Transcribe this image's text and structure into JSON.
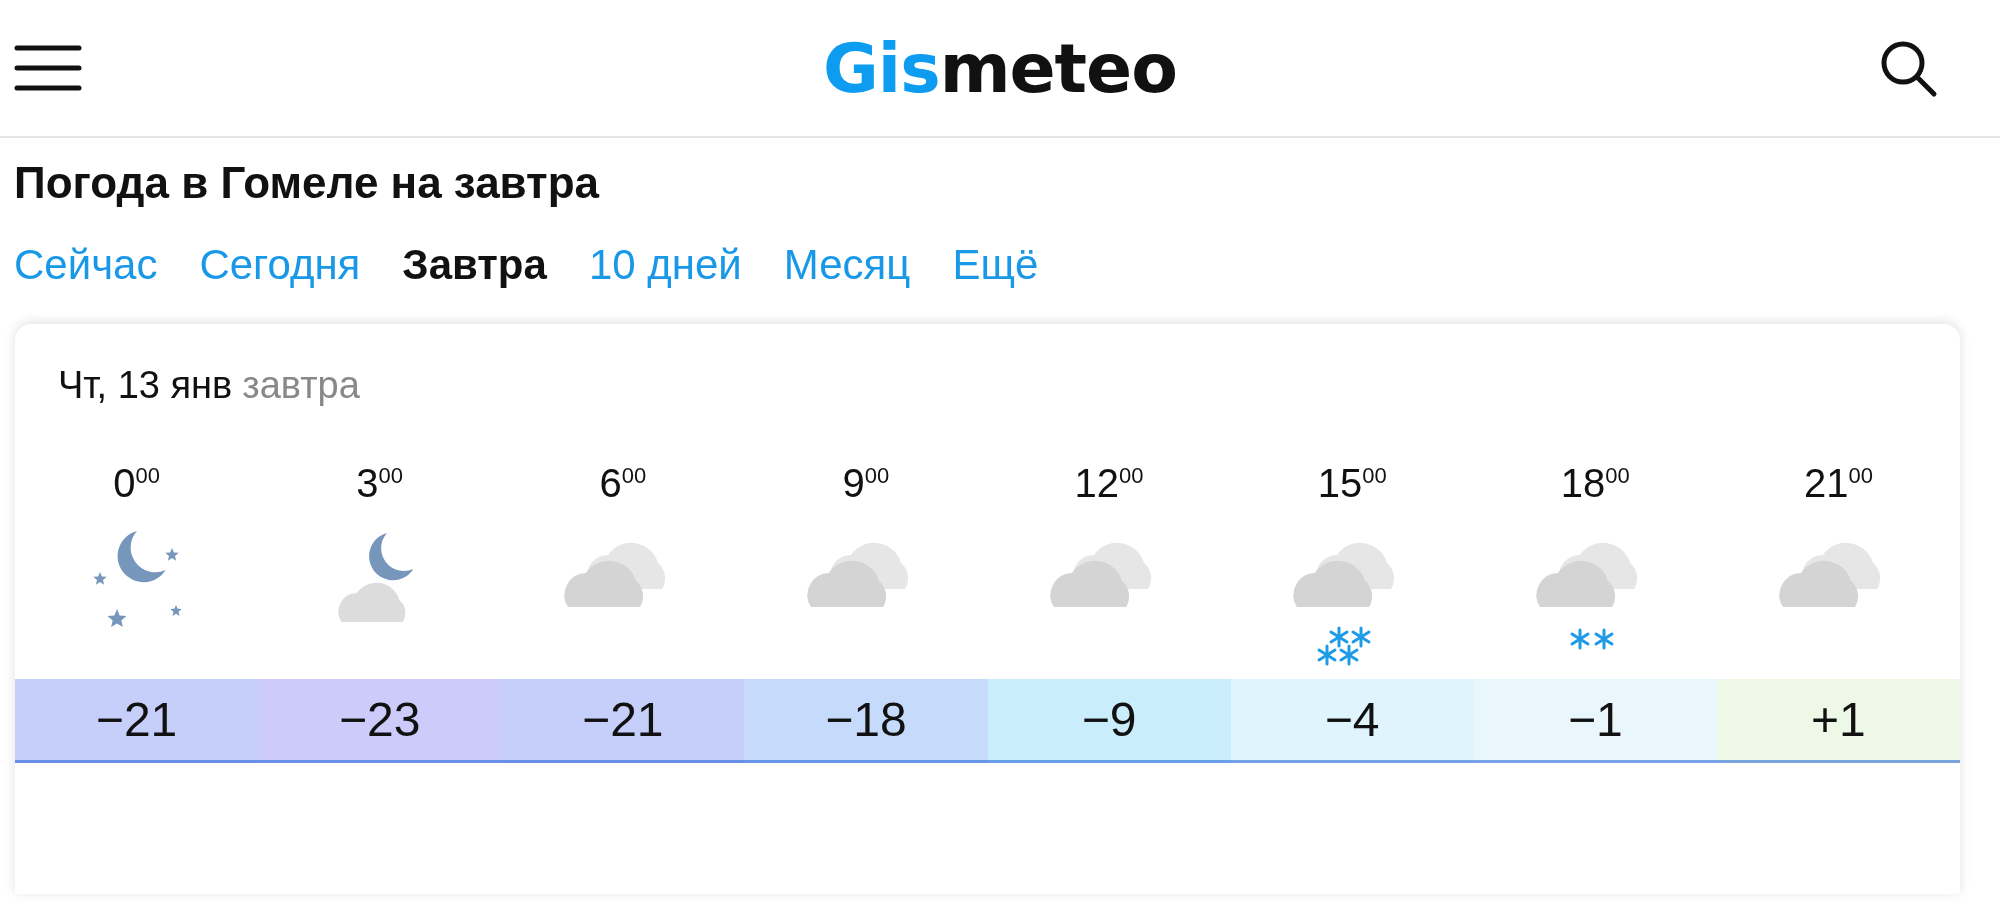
{
  "header": {
    "logo": {
      "accent": "Gis",
      "rest": "meteo"
    }
  },
  "title": "Погода в Гомеле на завтра",
  "tabs": [
    {
      "label": "Сейчас",
      "selected": false
    },
    {
      "label": "Сегодня",
      "selected": false
    },
    {
      "label": "Завтра",
      "selected": true
    },
    {
      "label": "10 дней",
      "selected": false
    },
    {
      "label": "Месяц",
      "selected": false
    },
    {
      "label": "Ещё",
      "selected": false
    }
  ],
  "forecast": {
    "date": "Чт, 13 янв",
    "date_note": "завтра",
    "hours": [
      {
        "time": "0$^{00}$",
        "kind": "moon-stars",
        "temperature": "−21",
        "color": "#c5cff9"
      },
      {
        "time": "3$^{00}$",
        "kind": "moon-cloud",
        "temperature": "−23",
        "color": "#cccbfa"
      },
      {
        "time": "6$^{00}$",
        "kind": "clouds",
        "temperature": "−21",
        "color": "#c5cff9"
      },
      {
        "time": "9$^{00}$",
        "kind": "clouds",
        "temperature": "−18",
        "color": "#c6dafb"
      },
      {
        "time": "12$^{00}$",
        "kind": "clouds",
        "temperature": "−9",
        "color": "#c9edfb"
      },
      {
        "time": "15$^{00}$",
        "kind": "clouds-heavy-snow",
        "temperature": "−4",
        "color": "#dff4fc"
      },
      {
        "time": "18$^{00}$",
        "kind": "clouds-light-snow",
        "temperature": "−1",
        "color": "#e9f7fd"
      },
      {
        "time": "21$^{00}$",
        "kind": "clouds",
        "temperature": "+1",
        "color": "#edf8e6"
      }
    ]
  }
}
